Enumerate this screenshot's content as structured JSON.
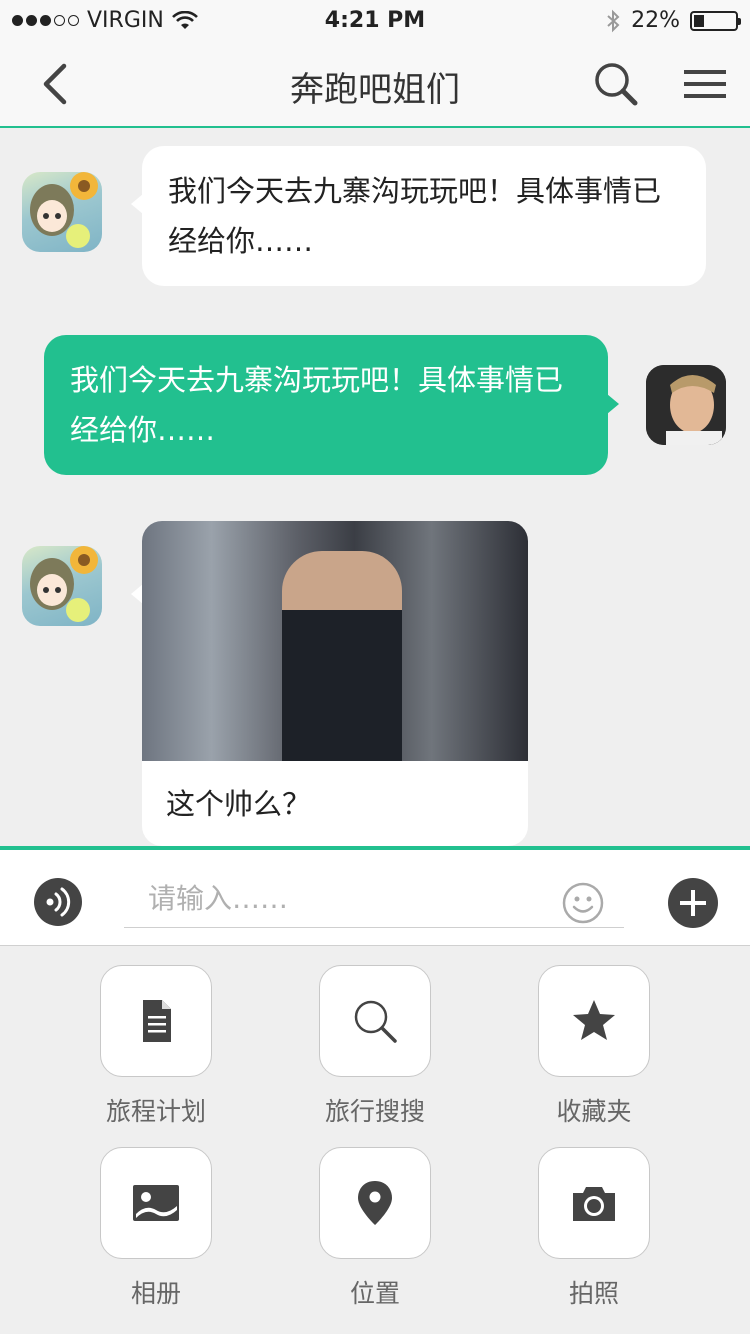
{
  "status_bar": {
    "carrier": "VIRGIN",
    "time": "4:21 PM",
    "battery": "22%",
    "signal_bars_filled": 3,
    "signal_bars_total": 5
  },
  "nav": {
    "title": "奔跑吧姐们",
    "back_icon": "chevron-left-icon",
    "search_icon": "search-icon",
    "menu_icon": "menu-icon"
  },
  "messages": [
    {
      "side": "incoming",
      "text_line1": "我们今天去九寨沟玩玩吧！具体事情已",
      "text_line2": "经给你……"
    },
    {
      "side": "outgoing",
      "text_line1": "我们今天去九寨沟玩玩吧！具体事情已",
      "text_line2": "经给你……"
    },
    {
      "side": "incoming",
      "type": "image",
      "caption": "这个帅么？"
    }
  ],
  "input": {
    "placeholder": "请输入……",
    "voice_icon": "voice-icon",
    "emoji_icon": "emoji-icon",
    "plus_icon": "plus-icon"
  },
  "tools": [
    {
      "label": "旅程计划",
      "icon": "document-icon"
    },
    {
      "label": "旅行搜搜",
      "icon": "search-icon"
    },
    {
      "label": "收藏夹",
      "icon": "star-icon"
    },
    {
      "label": "相册",
      "icon": "image-icon"
    },
    {
      "label": "位置",
      "icon": "location-pin-icon"
    },
    {
      "label": "拍照",
      "icon": "camera-icon"
    }
  ],
  "colors": {
    "accent": "#22c08f",
    "icon_dark": "#444444",
    "background": "#efefef"
  }
}
